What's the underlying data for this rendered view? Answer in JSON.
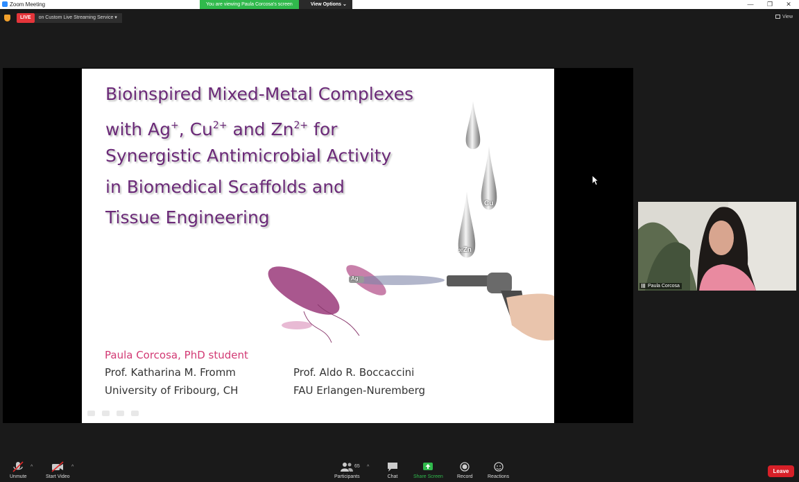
{
  "window": {
    "title": "Zoom Meeting",
    "minimize": "—",
    "restore": "❐",
    "close": "✕"
  },
  "banner": {
    "viewing_text": "You are viewing Paula Corcosa's screen",
    "view_options_label": "View Options"
  },
  "live": {
    "badge": "LIVE",
    "service": "on Custom Live Streaming Service"
  },
  "view_button": "View",
  "slide": {
    "title_lines": {
      "l1": "Bioinspired Mixed-Metal Complexes",
      "l2_a": "with Ag",
      "l2_sup1": "+",
      "l2_b": ", Cu",
      "l2_sup2": "2+",
      "l2_c": " and Zn",
      "l2_sup3": "2+",
      "l2_d": " for",
      "l3": "Synergistic Antimicrobial Activity",
      "l4": "in Biomedical Scaffolds and",
      "l5": "Tissue Engineering"
    },
    "presenter": "Paula Corcosa, PhD student",
    "supervisor_left": "Prof. Katharina M. Fromm",
    "affiliation_left": "University of Fribourg, CH",
    "supervisor_right": "Prof. Aldo R. Boccaccini",
    "affiliation_right": "FAU Erlangen-Nuremberg",
    "drop_labels": {
      "cu": "Cu",
      "zn_prefix": "30",
      "zn": "Zn",
      "ag": "Ag"
    }
  },
  "participant_video": {
    "name": "Paula Corcosa"
  },
  "toolbar": {
    "unmute": "Unmute",
    "start_video": "Start Video",
    "participants": "Participants",
    "participants_count": "65",
    "chat": "Chat",
    "share_screen": "Share Screen",
    "record": "Record",
    "reactions": "Reactions",
    "leave": "Leave"
  },
  "colors": {
    "title_purple": "#6b2a78",
    "presenter_pink": "#d23a74",
    "share_green": "#30b94c",
    "leave_red": "#d72028",
    "live_red": "#e4353a"
  }
}
